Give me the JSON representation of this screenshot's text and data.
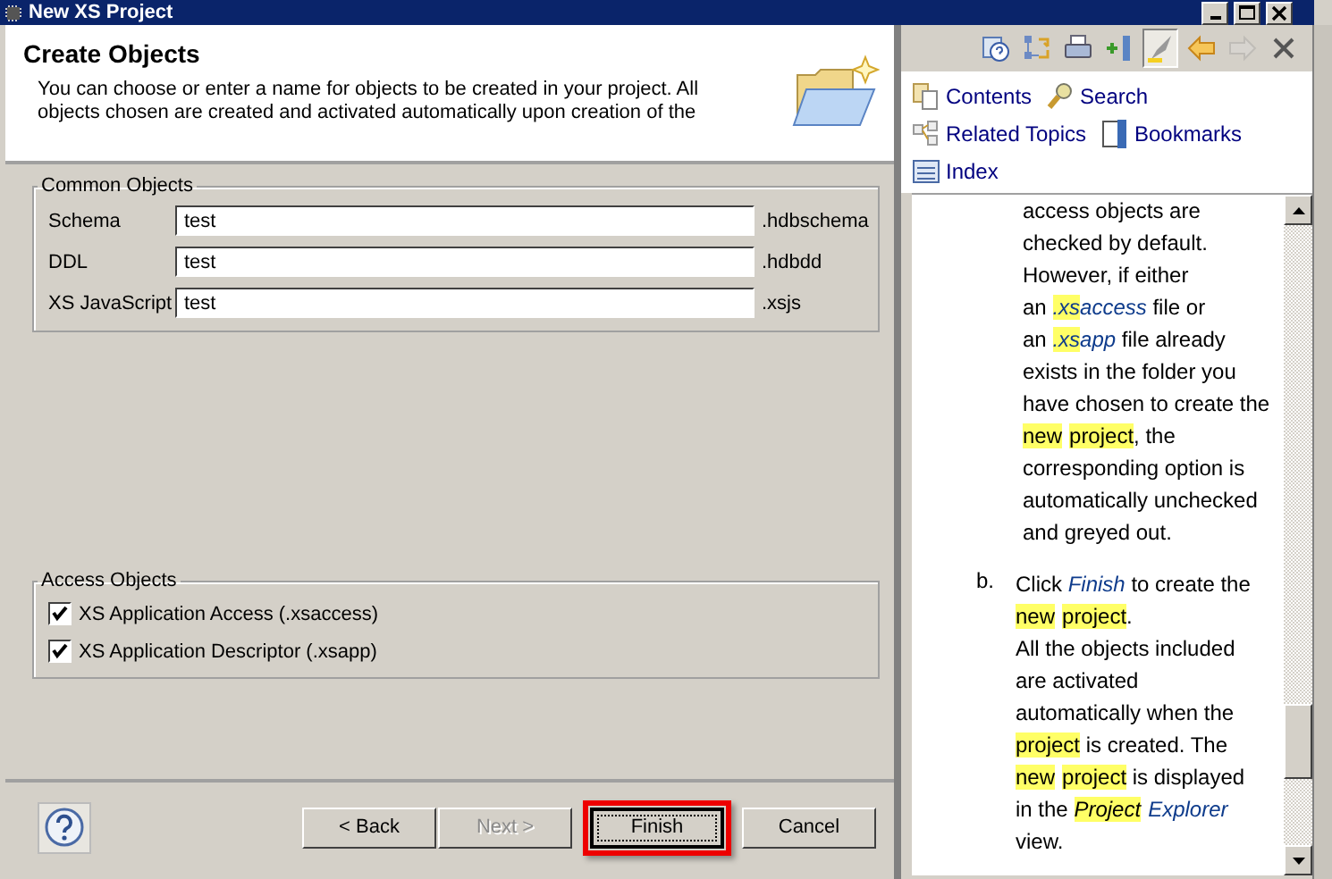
{
  "window": {
    "title": "New XS Project"
  },
  "header": {
    "title": "Create Objects",
    "description": "You can choose or enter a name for objects to be created in your project. All objects chosen are created and activated automatically upon creation of the"
  },
  "common_objects": {
    "title": "Common Objects",
    "fields": [
      {
        "label": "Schema",
        "value": "test",
        "suffix": ".hdbschema"
      },
      {
        "label": "DDL",
        "value": "test",
        "suffix": ".hdbdd"
      },
      {
        "label": "XS JavaScript",
        "value": "test",
        "suffix": ".xsjs"
      }
    ]
  },
  "access_objects": {
    "title": "Access Objects",
    "options": [
      {
        "label": "XS Application Access (.xsaccess)",
        "checked": true
      },
      {
        "label": "XS Application Descriptor (.xsapp)",
        "checked": true
      }
    ]
  },
  "buttons": [
    {
      "label": "< Back",
      "disabled": false,
      "focused": false
    },
    {
      "label": "Next >",
      "disabled": true,
      "focused": false
    },
    {
      "label": "Finish",
      "disabled": false,
      "focused": true,
      "annotated": true
    },
    {
      "label": "Cancel",
      "disabled": false,
      "focused": false
    }
  ],
  "help": {
    "toolbar": [
      {
        "kind": "help",
        "pressed": false,
        "disabled": false
      },
      {
        "kind": "sync",
        "pressed": false,
        "disabled": false
      },
      {
        "kind": "print",
        "pressed": false,
        "disabled": false
      },
      {
        "kind": "bookmark",
        "pressed": false,
        "disabled": false
      },
      {
        "kind": "highlight",
        "pressed": true,
        "disabled": false
      },
      {
        "kind": "back",
        "pressed": false,
        "disabled": false
      },
      {
        "kind": "forward",
        "pressed": false,
        "disabled": true
      },
      {
        "kind": "close",
        "pressed": false,
        "disabled": false
      }
    ],
    "links": [
      {
        "kind": "contents",
        "label": "Contents"
      },
      {
        "kind": "search",
        "label": "Search"
      },
      {
        "kind": "related",
        "label": "Related Topics"
      },
      {
        "kind": "bookmarks",
        "label": "Bookmarks"
      },
      {
        "kind": "index",
        "label": "Index"
      }
    ],
    "blocks": [
      {
        "lines": [
          [
            {
              "text": "access objects are"
            }
          ],
          [
            {
              "text": "checked by default."
            }
          ],
          [
            {
              "text": "However, if either"
            }
          ],
          [
            {
              "text": "an "
            },
            {
              "text": ".xs",
              "link": true,
              "highlight": true
            },
            {
              "text": "access",
              "link": true
            },
            {
              "text": " file or"
            }
          ],
          [
            {
              "text": "an "
            },
            {
              "text": ".xs",
              "link": true,
              "highlight": true
            },
            {
              "text": "app",
              "link": true
            },
            {
              "text": " file already"
            }
          ],
          [
            {
              "text": "exists in the folder you"
            }
          ],
          [
            {
              "text": "have chosen to create the"
            }
          ],
          [
            {
              "text": "new",
              "highlight": true
            },
            {
              "text": "project",
              "highlight": true,
              "space_before": true
            },
            {
              "text": ", the"
            }
          ],
          [
            {
              "text": "corresponding option is"
            }
          ],
          [
            {
              "text": "automatically unchecked"
            }
          ],
          [
            {
              "text": "and greyed out."
            }
          ]
        ]
      },
      {
        "marker": "b.",
        "lines": [
          [
            {
              "text": "Click "
            },
            {
              "text": "Finish",
              "link": true
            },
            {
              "text": " to create the"
            }
          ],
          [
            {
              "text": "new",
              "highlight": true
            },
            {
              "text": "project",
              "highlight": true,
              "space_before": true
            },
            {
              "text": "."
            }
          ],
          [
            {
              "text": "All the objects included"
            }
          ],
          [
            {
              "text": "are activated"
            }
          ],
          [
            {
              "text": "automatically when the"
            }
          ],
          [
            {
              "text": "project",
              "highlight": true
            },
            {
              "text": " is created. The"
            }
          ],
          [
            {
              "text": "new",
              "highlight": true
            },
            {
              "text": "project",
              "highlight": true,
              "space_before": true
            },
            {
              "text": " is displayed"
            }
          ],
          [
            {
              "text": "in the "
            },
            {
              "text": "Project",
              "italic": true,
              "highlight": true
            },
            {
              "text": "Explorer",
              "link": true,
              "space_before": true
            }
          ],
          [
            {
              "text": "view."
            }
          ]
        ]
      }
    ]
  }
}
